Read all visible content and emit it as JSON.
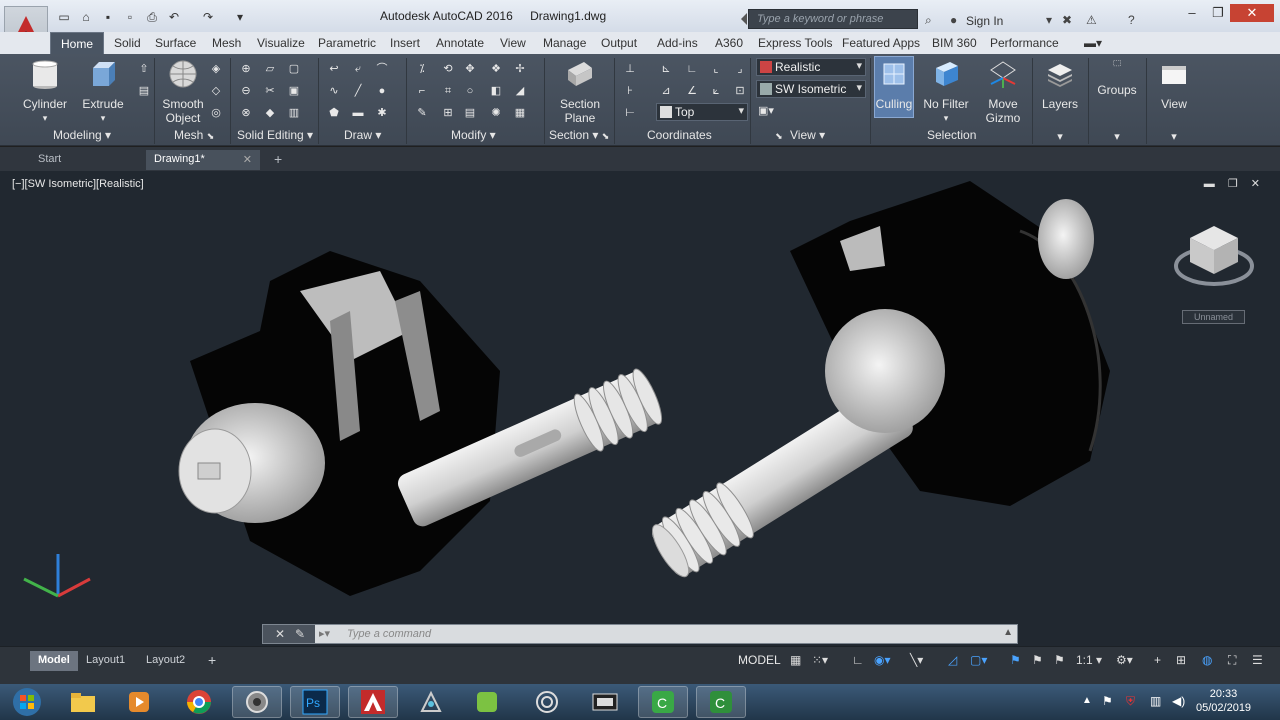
{
  "titlebar": {
    "app_name": "Autodesk AutoCAD 2016",
    "document": "Drawing1.dwg",
    "search_placeholder": "Type a keyword or phrase",
    "sign_in": "Sign In"
  },
  "ribbon_tabs": [
    "Home",
    "Solid",
    "Surface",
    "Mesh",
    "Visualize",
    "Parametric",
    "Insert",
    "Annotate",
    "View",
    "Manage",
    "Output",
    "Add-ins",
    "A360",
    "Express Tools",
    "Featured Apps",
    "BIM 360",
    "Performance"
  ],
  "ribbon": {
    "cylinder": "Cylinder",
    "extrude": "Extrude",
    "smooth_object": "Smooth\nObject",
    "section_plane": "Section\nPlane",
    "culling": "Culling",
    "no_filter": "No Filter",
    "move_gizmo": "Move\nGizmo",
    "layers": "Layers",
    "groups": "Groups",
    "view": "View",
    "visual_style": "Realistic",
    "view_preset": "SW Isometric",
    "ucs": "Top",
    "panels": [
      "Modeling",
      "Mesh",
      "Solid Editing",
      "Draw",
      "Modify",
      "Section",
      "Coordinates",
      "View",
      "Selection"
    ]
  },
  "file_tabs": {
    "start": "Start",
    "drawing": "Drawing1*"
  },
  "viewport": {
    "label": "[−][SW Isometric][Realistic]",
    "ucs_name": "Unnamed",
    "command_placeholder": "Type a command"
  },
  "layout_tabs": [
    "Model",
    "Layout1",
    "Layout2"
  ],
  "status": {
    "model": "MODEL",
    "scale": "1:1"
  },
  "clock": {
    "time": "20:33",
    "date": "05/02/2019"
  },
  "colors": {
    "autocad_red": "#c32b2b",
    "ribbon_bg": "#434c58",
    "viewport_bg": "#212830"
  }
}
